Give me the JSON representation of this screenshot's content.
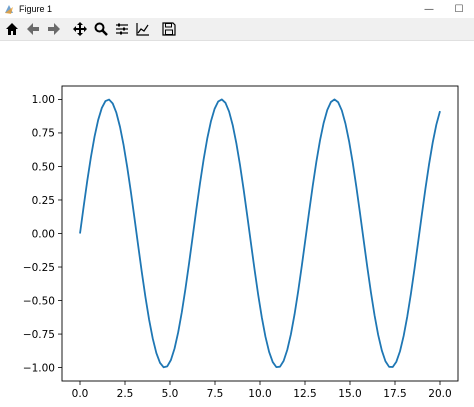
{
  "window": {
    "title": "Figure 1",
    "minimize_glyph": "—",
    "maximize_glyph": "☐"
  },
  "toolbar": {
    "buttons": [
      {
        "icon": "home-icon",
        "name": "home-button"
      },
      {
        "icon": "back-arrow-icon",
        "name": "back-button"
      },
      {
        "icon": "forward-arrow-icon",
        "name": "forward-button"
      },
      {
        "icon": "pan-move-icon",
        "name": "pan-button"
      },
      {
        "icon": "zoom-magnifier-icon",
        "name": "zoom-button"
      },
      {
        "icon": "configure-subplots-icon",
        "name": "subplots-button"
      },
      {
        "icon": "edit-axis-icon",
        "name": "edit-axis-button"
      },
      {
        "icon": "save-floppy-icon",
        "name": "save-button"
      }
    ]
  },
  "colors": {
    "line": "#1f77b4",
    "toolbar_bg": "#f0f0f0"
  },
  "chart_data": {
    "type": "line",
    "title": "",
    "xlabel": "",
    "ylabel": "",
    "function": "sin(x)",
    "x_range": [
      0,
      20
    ],
    "num_points": 100,
    "xlim": [
      -1.0,
      21.0
    ],
    "ylim": [
      -1.1,
      1.1
    ],
    "xticks": [
      0.0,
      2.5,
      5.0,
      7.5,
      10.0,
      12.5,
      15.0,
      17.5,
      20.0
    ],
    "xtick_labels": [
      "0.0",
      "2.5",
      "5.0",
      "7.5",
      "10.0",
      "12.5",
      "15.0",
      "17.5",
      "20.0"
    ],
    "yticks": [
      1.0,
      0.75,
      0.5,
      0.25,
      0.0,
      -0.25,
      -0.5,
      -0.75,
      -1.0
    ],
    "ytick_labels": [
      "1.00",
      "0.75",
      "0.50",
      "0.25",
      "0.00",
      "−0.25",
      "−0.50",
      "−0.75",
      "−1.00"
    ],
    "grid": false,
    "legend": "none"
  }
}
